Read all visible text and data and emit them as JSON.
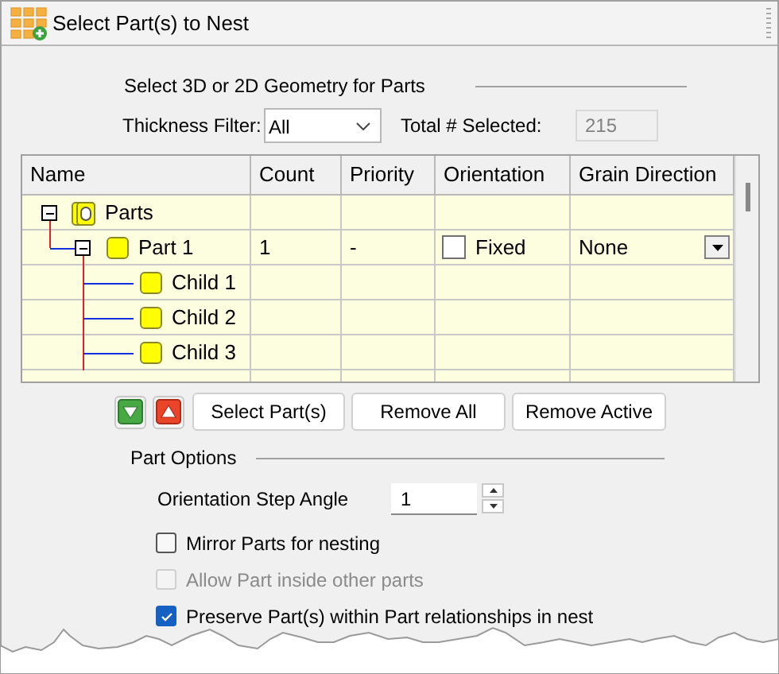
{
  "window": {
    "title": "Select Part(s) to Nest"
  },
  "geometry_section": {
    "heading": "Select 3D or 2D Geometry for Parts",
    "thickness_filter": {
      "label": "Thickness Filter:",
      "value": "All"
    },
    "total_selected": {
      "label": "Total # Selected:",
      "value": "215",
      "disabled": true
    }
  },
  "table": {
    "columns": [
      "Name",
      "Count",
      "Priority",
      "Orientation",
      "Grain Direction"
    ],
    "rows": [
      {
        "name": "Parts",
        "kind": "assembly",
        "expanded": true,
        "children": [
          {
            "name": "Part 1",
            "kind": "part",
            "expanded": true,
            "count": "1",
            "priority": "-",
            "orientation": {
              "label": "Fixed",
              "checked": false
            },
            "grain_direction": "None",
            "children": [
              {
                "name": "Child 1",
                "kind": "part"
              },
              {
                "name": "Child 2",
                "kind": "part"
              },
              {
                "name": "Child 3",
                "kind": "part"
              }
            ]
          }
        ]
      }
    ]
  },
  "buttons": [
    "Select Part(s)",
    "Remove All",
    "Remove Active"
  ],
  "part_options": {
    "heading": "Part Options",
    "step_angle": {
      "label": "Orientation Step Angle",
      "value": "1"
    },
    "options": [
      {
        "label": "Mirror Parts for nesting",
        "checked": false,
        "disabled": false
      },
      {
        "label": "Allow Part inside other parts",
        "checked": false,
        "disabled": true
      },
      {
        "label": "Preserve Part(s) within Part relationships in nest",
        "checked": true,
        "disabled": false
      }
    ]
  }
}
